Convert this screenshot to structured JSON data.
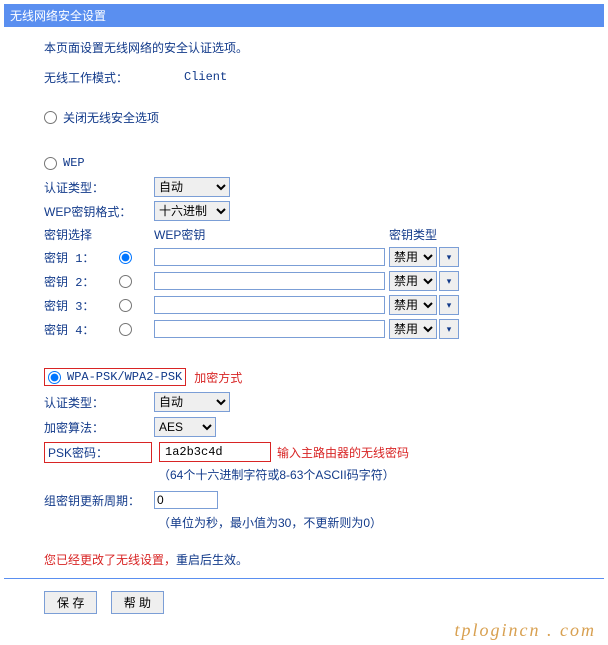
{
  "title": "无线网络安全设置",
  "intro": "本页面设置无线网络的安全认证选项。",
  "mode_label": "无线工作模式：",
  "mode_value": "Client",
  "option_disable": "关闭无线安全选项",
  "option_wep": "WEP",
  "wep": {
    "auth_label": "认证类型：",
    "auth_value": "自动",
    "format_label": "WEP密钥格式：",
    "format_value": "十六进制",
    "key_select": "密钥选择",
    "col_key": "WEP密钥",
    "col_type": "密钥类型",
    "disabled": "禁用",
    "keys": [
      {
        "label": "密钥 1：",
        "value": ""
      },
      {
        "label": "密钥 2：",
        "value": ""
      },
      {
        "label": "密钥 3：",
        "value": ""
      },
      {
        "label": "密钥 4：",
        "value": ""
      }
    ]
  },
  "option_wpa": "WPA-PSK/WPA2-PSK",
  "wpa": {
    "method_label": "加密方式",
    "auth_label": "认证类型：",
    "auth_value": "自动",
    "algo_label": "加密算法：",
    "algo_value": "AES",
    "psk_label": "PSK密码：",
    "psk_value": "1a2b3c4d",
    "psk_hint": "输入主路由器的无线密码",
    "psk_note": "（64个十六进制字符或8-63个ASCII码字符）",
    "rekey_label": "组密钥更新周期：",
    "rekey_value": "0",
    "rekey_note": "（单位为秒，最小值为30，不更新则为0）"
  },
  "changed_msg_prefix": "您已经更改了无线设置，",
  "changed_msg_suffix": "重启后生效。",
  "btn_save": "保 存",
  "btn_help": "帮 助",
  "brand": "tplogincn . com"
}
